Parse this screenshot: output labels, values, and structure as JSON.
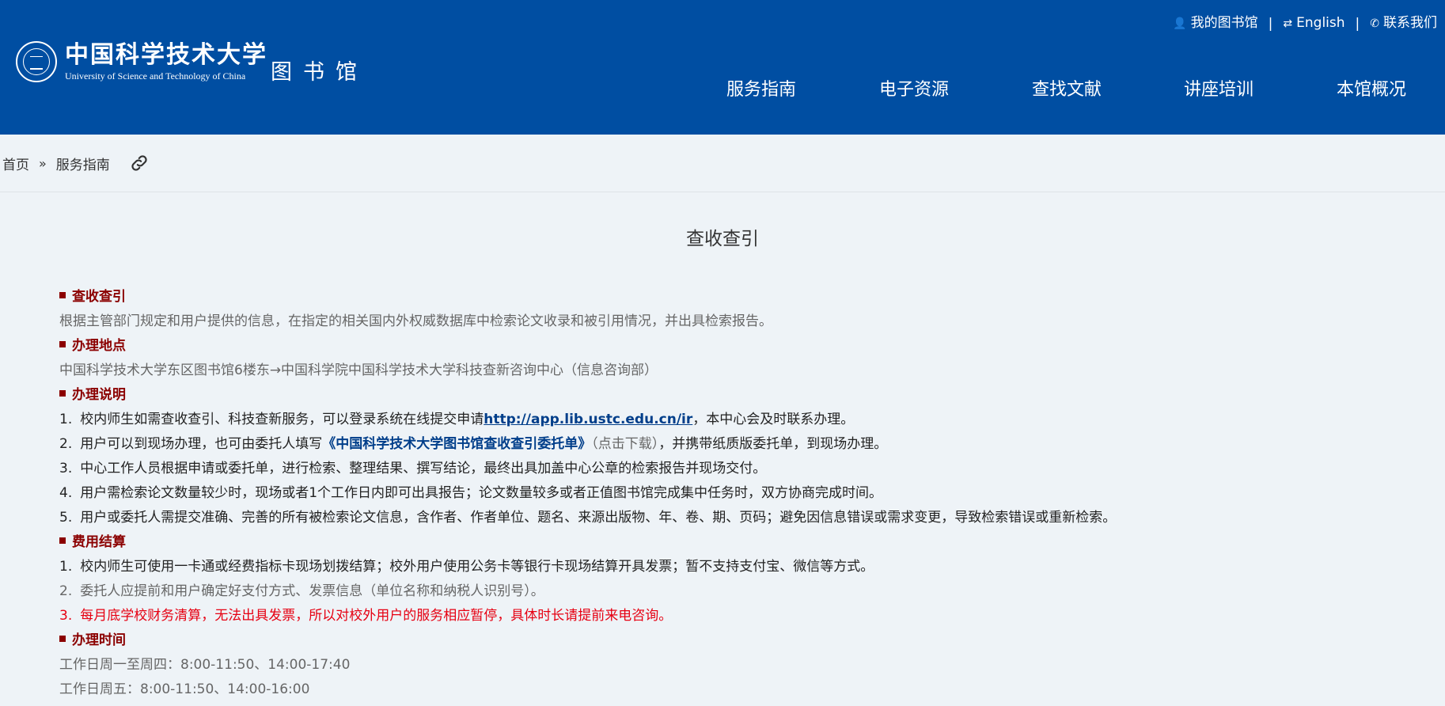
{
  "header": {
    "logo_cn": "中国科学技术大学",
    "logo_en": "University of Science and Technology of China",
    "library_name": "图书馆",
    "top_links": [
      {
        "icon": "user-icon",
        "glyph": "👤",
        "label": "我的图书馆"
      },
      {
        "icon": "exchange-icon",
        "glyph": "⇄",
        "label": "English"
      },
      {
        "icon": "phone-icon",
        "glyph": "✆",
        "label": "联系我们"
      }
    ],
    "separator": "|",
    "nav": [
      "服务指南",
      "电子资源",
      "查找文献",
      "讲座培训",
      "本馆概况"
    ]
  },
  "breadcrumb": {
    "home": "首页",
    "arrow": "»",
    "current": "服务指南"
  },
  "page": {
    "title": "查收查引",
    "sections": {
      "s1_heading": "查收查引",
      "s1_text": "根据主管部门规定和用户提供的信息，在指定的相关国内外权威数据库中检索论文收录和被引用情况，并出具检索报告。",
      "s2_heading": "办理地点",
      "s2_text": "中国科学技术大学东区图书馆6楼东→中国科学院中国科学技术大学科技查新咨询中心（信息咨询部）",
      "s3_heading": "办理说明",
      "s3_items": {
        "i1_num": "1.",
        "i1_pre": "校内师生如需查收查引、科技查新服务，可以登录系统在线提交申请",
        "i1_link": "http://app.lib.ustc.edu.cn/ir",
        "i1_post": "，本中心会及时联系办理。",
        "i2_num": "2.",
        "i2_pre": "用户可以到现场办理，也可由委托人填写",
        "i2_link": "《中国科学技术大学图书馆查收查引委托单》",
        "i2_download": "（点击下载）",
        "i2_post": "，并携带纸质版委托单，到现场办理。",
        "i3_num": "3.",
        "i3_text": "中心工作人员根据申请或委托单，进行检索、整理结果、撰写结论，最终出具加盖中心公章的检索报告并现场交付。",
        "i4_num": "4.",
        "i4_text": "用户需检索论文数量较少时，现场或者1个工作日内即可出具报告；论文数量较多或者正值图书馆完成集中任务时，双方协商完成时间。",
        "i5_num": "5.",
        "i5_text": "用户或委托人需提交准确、完善的所有被检索论文信息，含作者、作者单位、题名、来源出版物、年、卷、期、页码；避免因信息错误或需求变更，导致检索错误或重新检索。"
      },
      "s4_heading": "费用结算",
      "s4_items": {
        "i1_num": "1.",
        "i1_text": "校内师生可使用一卡通或经费指标卡现场划拨结算；校外用户使用公务卡等银行卡现场结算开具发票；暂不支持支付宝、微信等方式。",
        "i2_num": "2.",
        "i2_text": "委托人应提前和用户确定好支付方式、发票信息（单位名称和纳税人识别号）。",
        "i3_num": "3.",
        "i3_text": "每月底学校财务清算，无法出具发票，所以对校外用户的服务相应暂停，具体时长请提前来电咨询。"
      },
      "s5_heading": "办理时间",
      "s5_line1": "工作日周一至周四：8:00-11:50、14:00-17:40",
      "s5_line2": "工作日周五：8:00-11:50、14:00-16:00"
    }
  },
  "colors": {
    "header_bg": "#004ea2",
    "heading": "#8b0000",
    "link": "#003e8a",
    "warning": "#e60012",
    "page_bg": "#eef3f7"
  }
}
